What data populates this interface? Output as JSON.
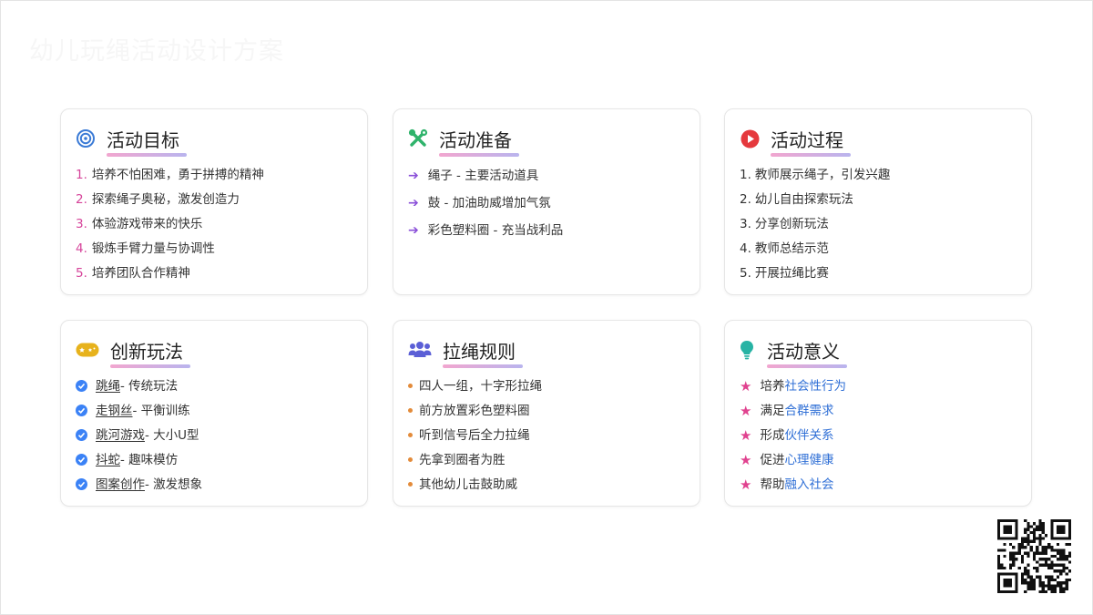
{
  "page": {
    "title": "幼儿玩绳活动设计方案"
  },
  "cards": {
    "goals": {
      "title": "活动目标",
      "icon": "target-icon",
      "items": [
        "培养不怕困难，勇于拼搏的精神",
        "探索绳子奥秘，激发创造力",
        "体验游戏带来的快乐",
        "锻炼手臂力量与协调性",
        "培养团队合作精神"
      ],
      "numbers": [
        "1.",
        "2.",
        "3.",
        "4.",
        "5."
      ]
    },
    "prep": {
      "title": "活动准备",
      "icon": "tools-icon",
      "items": [
        "绳子 - 主要活动道具",
        "鼓 - 加油助威增加气氛",
        "彩色塑料圈 - 充当战利品"
      ]
    },
    "process": {
      "title": "活动过程",
      "icon": "play-icon",
      "items": [
        "教师展示绳子，引发兴趣",
        "幼儿自由探索玩法",
        "分享创新玩法",
        "教师总结示范",
        "开展拉绳比赛"
      ],
      "numbers": [
        "1.",
        "2.",
        "3.",
        "4.",
        "5."
      ]
    },
    "play": {
      "title": "创新玩法",
      "icon": "gamepad-icon",
      "items": [
        {
          "name": "跳绳",
          "desc": " - 传统玩法"
        },
        {
          "name": "走钢丝",
          "desc": " - 平衡训练"
        },
        {
          "name": "跳河游戏",
          "desc": " - 大小U型"
        },
        {
          "name": "抖蛇",
          "desc": " - 趣味模仿"
        },
        {
          "name": "图案创作",
          "desc": " - 激发想象"
        }
      ]
    },
    "rules": {
      "title": "拉绳规则",
      "icon": "users-icon",
      "items": [
        "四人一组，十字形拉绳",
        "前方放置彩色塑料圈",
        "听到信号后全力拉绳",
        "先拿到圈者为胜",
        "其他幼儿击鼓助威"
      ]
    },
    "meaning": {
      "title": "活动意义",
      "icon": "lightbulb-icon",
      "items": [
        {
          "prefix": "培养",
          "highlight": "社会性行为"
        },
        {
          "prefix": "满足",
          "highlight": "合群需求"
        },
        {
          "prefix": "形成",
          "highlight": "伙伴关系"
        },
        {
          "prefix": "促进",
          "highlight": "心理健康"
        },
        {
          "prefix": "帮助",
          "highlight": "融入社会"
        }
      ]
    }
  },
  "colors": {
    "accent_pink": "#d6449a",
    "accent_purple": "#8a4fd8",
    "check_blue": "#3b82f6",
    "dot_orange": "#e38b3a",
    "highlight_blue": "#2f6fd6"
  }
}
